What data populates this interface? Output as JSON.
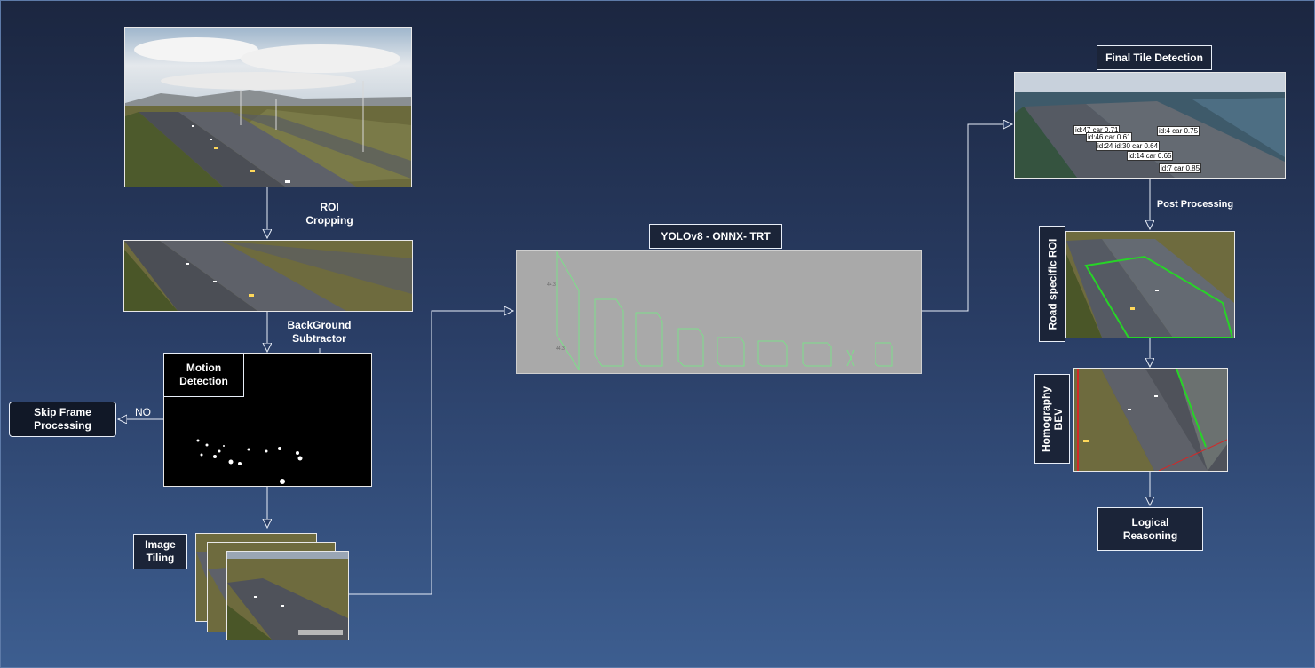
{
  "steps": {
    "roi_cropping": "ROI\nCropping",
    "background_subtractor": "BackGround\nSubtractor",
    "motion_detection": "Motion\nDetection",
    "skip_frame": "Skip Frame\nProcessing",
    "no_label": "NO",
    "image_tiling": "Image\nTiling",
    "yolo": "YOLOv8 - ONNX- TRT",
    "final_tile_detection": "Final Tile Detection",
    "post_processing": "Post Processing",
    "road_specific_roi": "Road specific ROI",
    "homography_bev": "Homography\nBEV",
    "logical_reasoning": "Logical\nReasoning"
  },
  "detections": [
    "id:47 car 0.71",
    "id:4 car 0.75",
    "id:46 car 0.61",
    "id:24 id:30 car 0.64",
    "id:14 car 0.65",
    "id:7 car 0.85"
  ],
  "colors": {
    "arrow": "#e8eef8",
    "roi_polygon": "#27d427",
    "bev_left_line": "#d42727",
    "bev_right_line": "#27d427",
    "network_layers": "#7ddf8a"
  }
}
